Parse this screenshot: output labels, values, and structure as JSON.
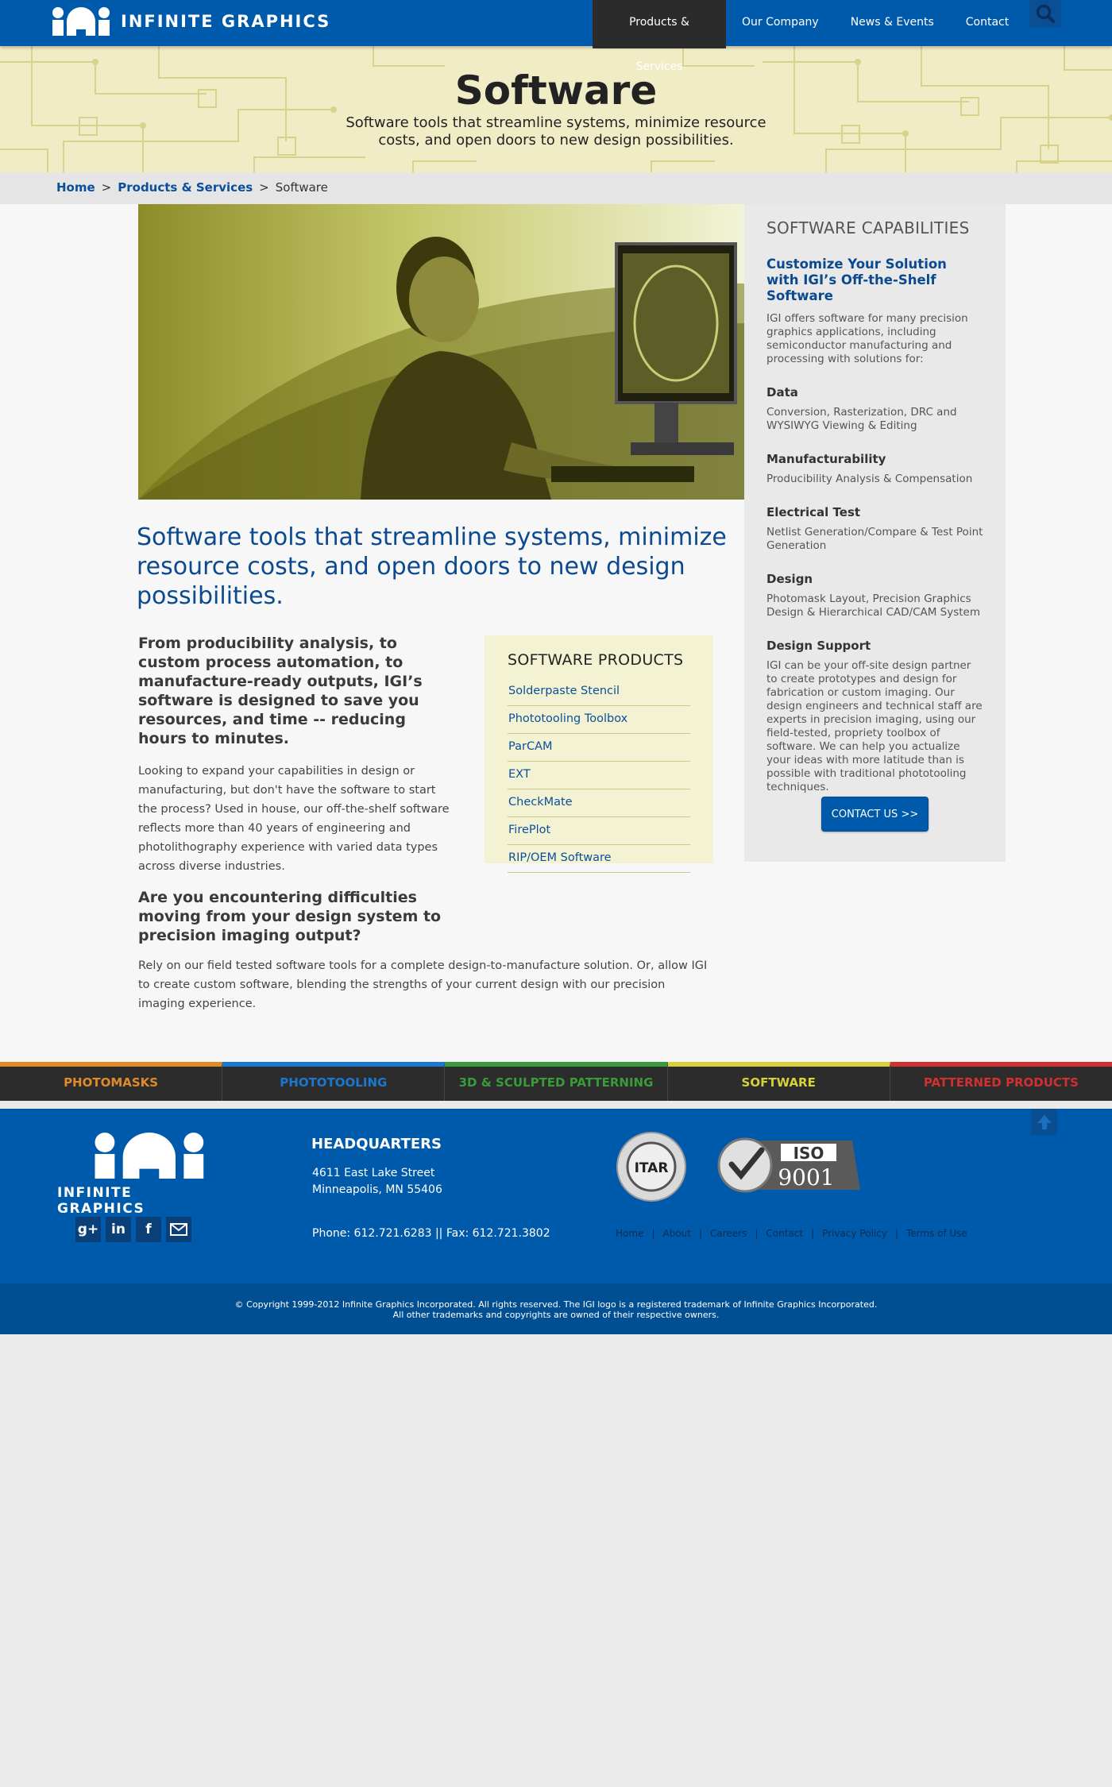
{
  "brand": {
    "logo_text": "INFINITE GRAPHICS"
  },
  "nav": {
    "items": [
      "Products & Services",
      "Our Company",
      "News & Events",
      "Contact"
    ]
  },
  "hero": {
    "title": "Software",
    "subtitle": "Software  tools that streamline systems, minimize resource costs, and open doors to new design possibilities."
  },
  "breadcrumb": {
    "home": "Home",
    "sep1": ">",
    "products": "Products & Services",
    "sep2": ">",
    "current": "Software"
  },
  "main": {
    "heading": "Software tools that streamline systems, minimize resource costs, and open doors to new design possibilities.",
    "lead": "From producibility analysis, to custom process automation, to manufacture-ready outputs, IGI’s software is designed to save you resources, and time -- reducing hours to minutes.",
    "body1": "Looking to expand your capabilities in design or manufacturing, but don't have the software to start the process? Used in house, our off-the-shelf software reflects more than 40 years of engineering and photolithography experience with varied data types across diverse industries.",
    "subheading": "Are you encountering difficulties moving from your design system to precision imaging output?",
    "body2": "Rely on our field tested software tools for a complete design-to-manufacture solution. Or, allow IGI to create custom software, blending the strengths of your current design with our precision imaging experience."
  },
  "products": {
    "title": "SOFTWARE PRODUCTS",
    "items": [
      "Solderpaste Stencil",
      "Phototooling Toolbox",
      "ParCAM",
      "EXT",
      "CheckMate",
      "FirePlot",
      "RIP/OEM Software"
    ]
  },
  "sidebar": {
    "title": "SOFTWARE CAPABILITIES",
    "subtitle": "Customize Your Solution with IGI’s Off-the-Shelf Software",
    "intro": "IGI offers software for many precision graphics applications, including semiconductor manufacturing and processing with solutions for:",
    "sections": [
      {
        "head": "Data",
        "text": "Conversion, Rasterization, DRC and WYSIWYG Viewing & Editing"
      },
      {
        "head": "Manufacturability",
        "text": "Producibility Analysis & Compensation"
      },
      {
        "head": "Electrical Test",
        "text": "Netlist Generation/Compare & Test Point Generation"
      },
      {
        "head": "Design",
        "text": "Photomask Layout, Precision Graphics Design & Hierarchical CAD/CAM System"
      },
      {
        "head": "Design Support",
        "text": "IGI can be your off-site design partner to create prototypes and design for fabrication or custom imaging. Our design engineers and technical staff are experts in precision imaging, using our field-tested, propriety toolbox of software. We can help you actualize your ideas with more latitude than is possible with traditional phototooling techniques."
      }
    ],
    "contact_label": "CONTACT US >>"
  },
  "categories": [
    {
      "label": "PHOTOMASKS",
      "color": "#e08a2a"
    },
    {
      "label": "PHOTOTOOLING",
      "color": "#1a78d0"
    },
    {
      "label": "3D & SCULPTED PATTERNING",
      "color": "#3a9b3a"
    },
    {
      "label": "SOFTWARE",
      "color": "#d6d23a"
    },
    {
      "label": "PATTERNED PRODUCTS",
      "color": "#d23030"
    }
  ],
  "footer": {
    "logo_text": "INFINITE GRAPHICS",
    "hq_title": "HEADQUARTERS",
    "address1": "4611 East Lake Street",
    "address2": "Minneapolis, MN 55406",
    "phone": "Phone: 612.721.6283  ||  Fax: 612.721.3802",
    "itar": "ITAR",
    "iso": "ISO",
    "iso_num": "9001",
    "links": [
      "Home",
      "|",
      "About",
      "|",
      "Careers",
      "|",
      "Contact",
      "|",
      "Privacy Policy",
      "|",
      "Terms of Use"
    ],
    "copyright1": "© Copyright 1999-2012 Infinite Graphics Incorporated. All rights reserved. The IGI logo is a registered trademark of Infinite Graphics Incorporated.",
    "copyright2": "All other trademarks and copyrights are owned of their respective owners."
  }
}
